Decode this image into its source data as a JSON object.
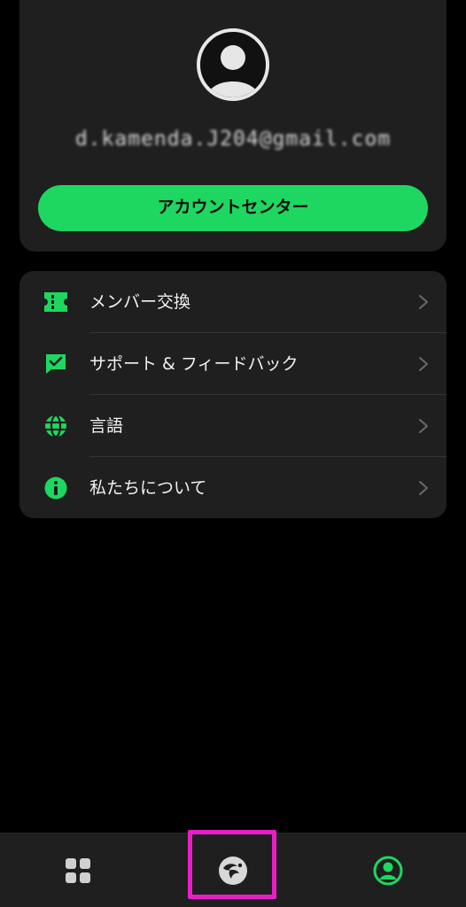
{
  "profile": {
    "email": "d.kamenda.J204@gmail.com",
    "account_center_label": "アカウントセンター"
  },
  "menu": {
    "items": [
      {
        "label": "メンバー交換",
        "icon": "ticket-icon"
      },
      {
        "label": "サポート & フィードバック",
        "icon": "feedback-icon"
      },
      {
        "label": "言語",
        "icon": "globe-icon"
      },
      {
        "label": "私たちについて",
        "icon": "info-icon"
      }
    ]
  },
  "bottom_nav": {
    "items": [
      {
        "icon": "grid-icon",
        "active": false
      },
      {
        "icon": "app-logo-icon",
        "active": false,
        "highlighted": true
      },
      {
        "icon": "profile-icon",
        "active": true
      }
    ]
  },
  "colors": {
    "accent": "#1ed760",
    "background": "#000000",
    "card": "#1f1f1f",
    "highlight_box": "#e81ec8"
  }
}
